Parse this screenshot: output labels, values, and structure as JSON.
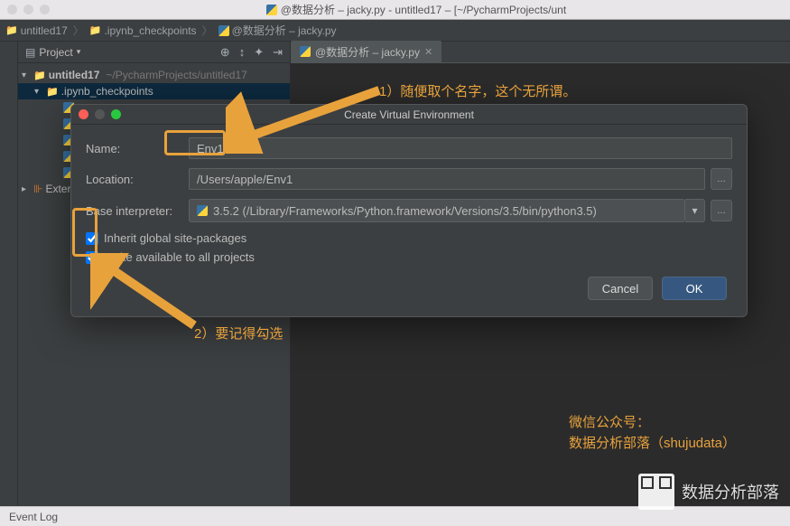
{
  "window": {
    "title": "@数据分析 – jacky.py - untitled17 – [~/PycharmProjects/unt"
  },
  "breadcrumb": {
    "project": "untitled17",
    "folder": ".ipynb_checkpoints",
    "file": "@数据分析 – jacky.py"
  },
  "sidebar": {
    "title": "Project",
    "project_name": "untitled17",
    "project_path": "~/PycharmProjects/untitled17",
    "checkpoints": ".ipynb_checkpoints",
    "external": "External Libraries",
    "toolbar": {
      "collapse": "⇤",
      "settings": "⚙",
      "sync": "⟳",
      "hide": "⇥"
    }
  },
  "editor": {
    "tab_label": "@数据分析 – jacky.py"
  },
  "dialog": {
    "title": "Create Virtual Environment",
    "name_label": "Name:",
    "name_value": "Env1",
    "location_label": "Location:",
    "location_value": "/Users/apple/Env1",
    "interpreter_label": "Base interpreter:",
    "interpreter_value": "3.5.2 (/Library/Frameworks/Python.framework/Versions/3.5/bin/python3.5)",
    "inherit_label": "Inherit global site-packages",
    "available_label": "Make available to all projects",
    "cancel": "Cancel",
    "ok": "OK"
  },
  "annotations": {
    "note1": "1）随便取个名字，这个无所谓。",
    "note2": "2）要记得勾选",
    "wechat_line1": "微信公众号：",
    "wechat_line2": "数据分析部落（shujudata）",
    "brand": "数据分析部落"
  },
  "statusbar": {
    "event_log": "Event Log"
  }
}
